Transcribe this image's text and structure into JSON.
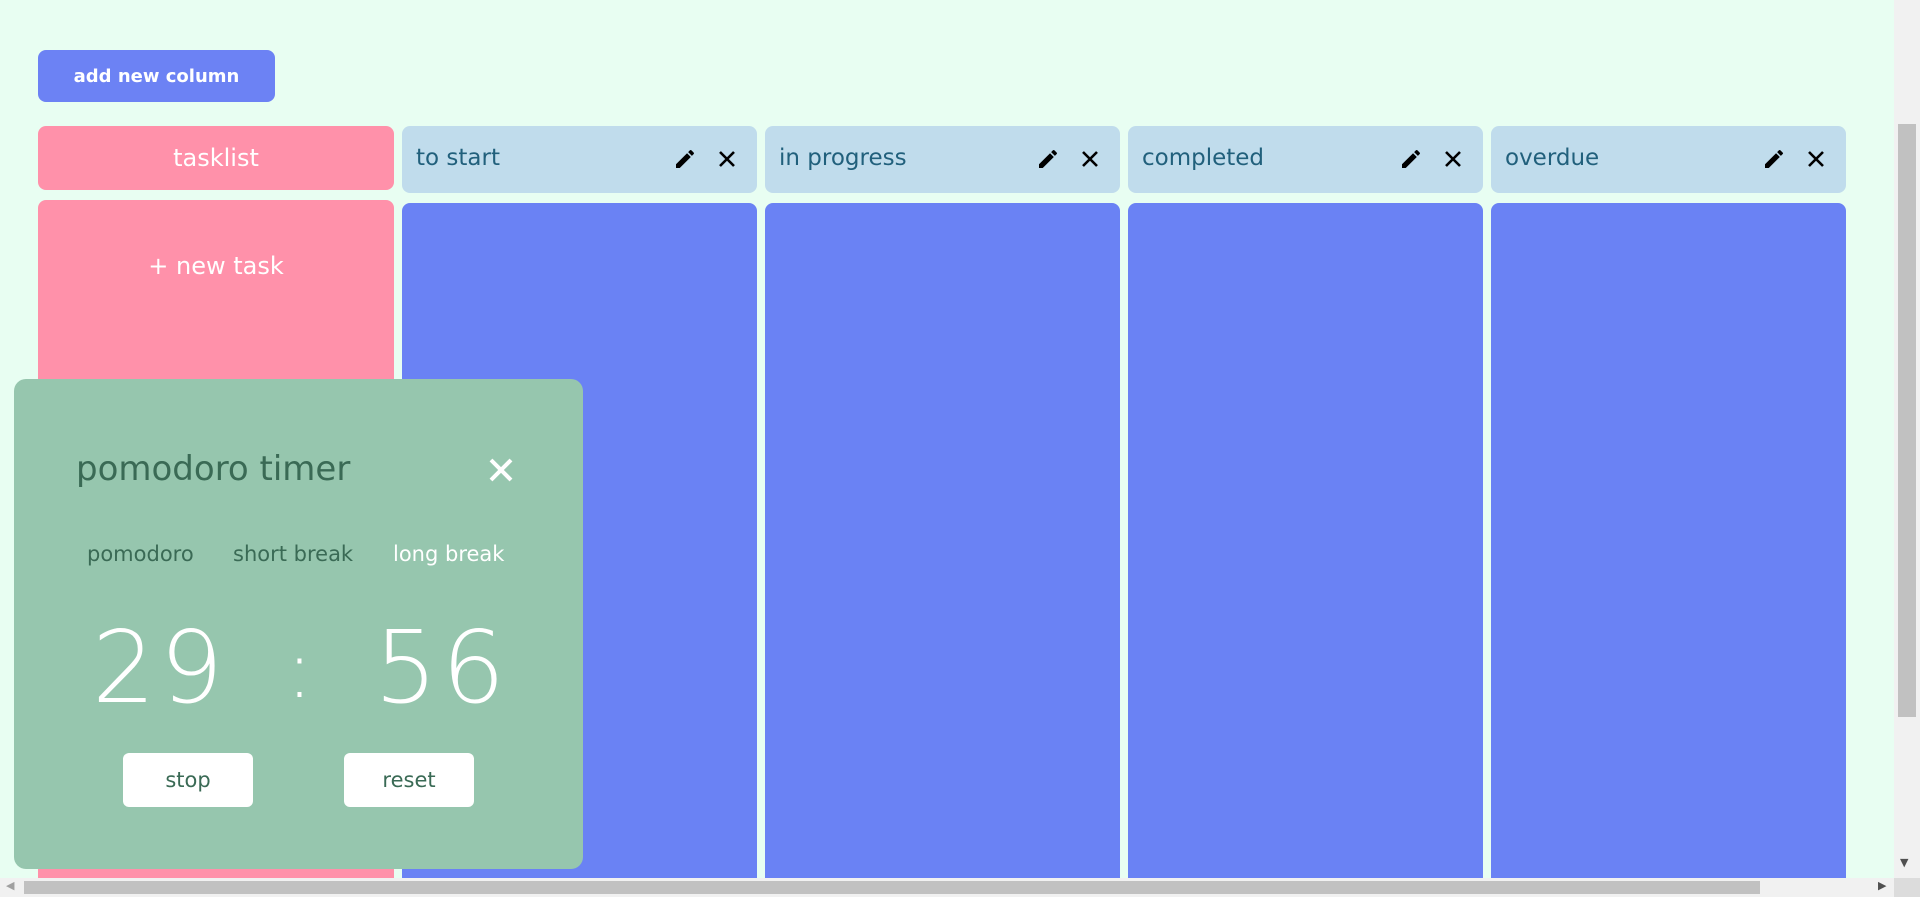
{
  "toolbar": {
    "add_column_label": "add new column"
  },
  "tasklist": {
    "title": "tasklist",
    "new_task_label": "+ new task"
  },
  "columns": [
    {
      "title": "to start"
    },
    {
      "title": "in progress"
    },
    {
      "title": "completed"
    },
    {
      "title": "overdue"
    }
  ],
  "pomodoro": {
    "title": "pomodoro timer",
    "modes": [
      "pomodoro",
      "short break",
      "long break"
    ],
    "active_mode": "long break",
    "minutes": "29",
    "separator": ":",
    "seconds": "56",
    "stop_label": "stop",
    "reset_label": "reset"
  },
  "colors": {
    "background": "#e8fef2",
    "accent": "#6c82f4",
    "tasklist": "#ff91aa",
    "column_header": "#c0dcec",
    "pomodoro_panel": "#96c6ae"
  },
  "icons": [
    "pencil-icon",
    "close-icon"
  ]
}
